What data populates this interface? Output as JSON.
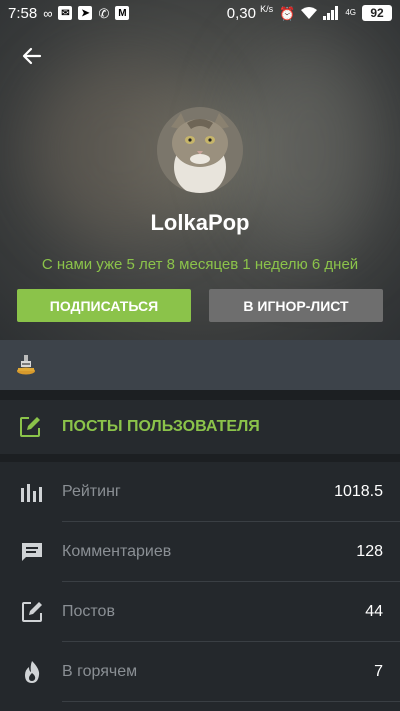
{
  "status_bar": {
    "time": "7:58",
    "speed": "0,30 ",
    "speed_unit": "K/s",
    "network": "4G",
    "battery": "92"
  },
  "profile": {
    "username": "LolkaPop",
    "member_since": "С нами уже 5 лет 8 месяцев 1 неделю 6 дней"
  },
  "actions": {
    "subscribe": "ПОДПИСАТЬСЯ",
    "ignore": "В ИГНОР-ЛИСТ"
  },
  "posts_section": {
    "label": "ПОСТЫ ПОЛЬЗОВАТЕЛЯ"
  },
  "stats": [
    {
      "icon": "rating-bars-icon",
      "name": "Рейтинг",
      "value": "1018.5"
    },
    {
      "icon": "comment-icon",
      "name": "Комментариев",
      "value": "128"
    },
    {
      "icon": "edit-post-icon",
      "name": "Постов",
      "value": "44"
    },
    {
      "icon": "fire-icon",
      "name": "В горячем",
      "value": "7"
    }
  ],
  "colors": {
    "accent": "#8bc34a",
    "background": "#24282c",
    "awards_bar": "#3d434a",
    "ignore_button": "#6e6e6e"
  }
}
